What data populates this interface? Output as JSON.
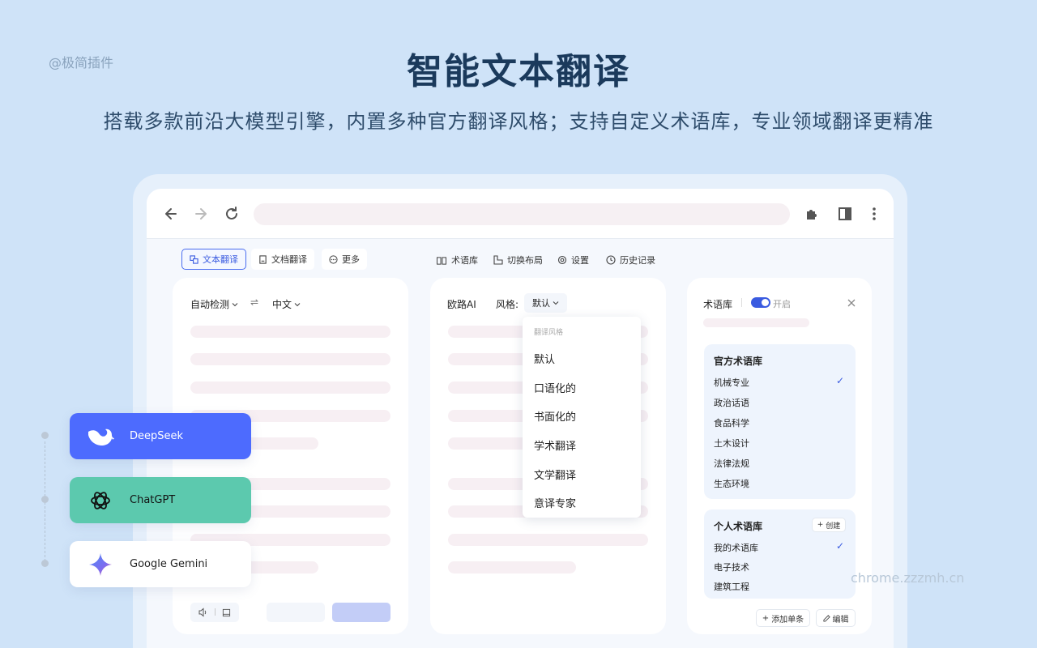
{
  "watermark_tl": "@极简插件",
  "watermark_br": "chrome.zzzmh.cn",
  "headline": "智能文本翻译",
  "subheadline": "搭载多款前沿大模型引擎，内置多种官方翻译风格；支持自定义术语库，专业领域翻译更精准",
  "toolbar": {
    "tab_text": "文本翻译",
    "tab_doc": "文档翻译",
    "tab_more": "更多",
    "glossary": "术语库",
    "switch_layout": "切换布局",
    "settings": "设置",
    "history": "历史记录"
  },
  "source": {
    "lang_from": "自动检测",
    "lang_to": "中文"
  },
  "target": {
    "engine": "欧路AI",
    "style_label": "风格:",
    "style_value": "默认"
  },
  "style_menu": {
    "heading": "翻译风格",
    "items": [
      "默认",
      "口语化的",
      "书面化的",
      "学术翻译",
      "文学翻译",
      "意译专家"
    ]
  },
  "glossary_panel": {
    "title": "术语库",
    "toggle_label": "开启",
    "toggle_on": true,
    "official_title": "官方术语库",
    "official_items": [
      "机械专业",
      "政治话语",
      "食品科学",
      "土木设计",
      "法律法规",
      "生态环境"
    ],
    "personal_title": "个人术语库",
    "create_label": "创建",
    "personal_items": [
      "我的术语库",
      "电子技术",
      "建筑工程"
    ],
    "add_entry_label": "添加单条",
    "edit_label": "编辑"
  },
  "engines": [
    {
      "name": "DeepSeek",
      "color": "#4d6bfe"
    },
    {
      "name": "ChatGPT",
      "color": "#5cc9ae"
    },
    {
      "name": "Google Gemini",
      "color": "#ffffff"
    }
  ]
}
